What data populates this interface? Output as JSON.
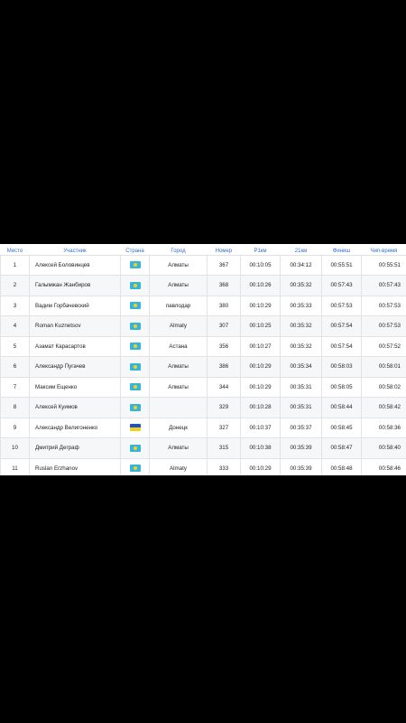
{
  "table": {
    "headers": [
      "Место",
      "Участник",
      "Страна",
      "Город",
      "Номер",
      "Р1км",
      "21км",
      "Финиш",
      "Чип-время"
    ],
    "rows": [
      {
        "place": "1",
        "name": "Алексей Боловинцев",
        "flag": "kz",
        "city": "Алматы",
        "number": "367",
        "split1": "00:10:05",
        "split2": "00:34:12",
        "finish": "00:55:51",
        "chip": "00:55:51"
      },
      {
        "place": "2",
        "name": "Галымжан Жанбиров",
        "flag": "kz",
        "city": "Алматы",
        "number": "368",
        "split1": "00:10:26",
        "split2": "00:35:32",
        "finish": "00:57:43",
        "chip": "00:57:43"
      },
      {
        "place": "3",
        "name": "Вадим Горбачевский",
        "flag": "kz",
        "city": "павлодар",
        "number": "380",
        "split1": "00:10:29",
        "split2": "00:35:33",
        "finish": "00:57:53",
        "chip": "00:57:53"
      },
      {
        "place": "4",
        "name": "Roman Kuznetsov",
        "flag": "kz",
        "city": "Almaty",
        "number": "307",
        "split1": "00:10:25",
        "split2": "00:35:32",
        "finish": "00:57:54",
        "chip": "00:57:53"
      },
      {
        "place": "5",
        "name": "Азамат Карасартов",
        "flag": "kz",
        "city": "Астана",
        "number": "356",
        "split1": "00:10:27",
        "split2": "00:35:32",
        "finish": "00:57:54",
        "chip": "00:57:52"
      },
      {
        "place": "6",
        "name": "Александр Пугачев",
        "flag": "kz",
        "city": "Алматы",
        "number": "386",
        "split1": "00:10:29",
        "split2": "00:35:34",
        "finish": "00:58:03",
        "chip": "00:58:01"
      },
      {
        "place": "7",
        "name": "Максим Ещенко",
        "flag": "kz",
        "city": "Алматы",
        "number": "344",
        "split1": "00:10:29",
        "split2": "00:35:31",
        "finish": "00:58:05",
        "chip": "00:58:02"
      },
      {
        "place": "8",
        "name": "Алексей Куимов",
        "flag": "kz",
        "city": "",
        "number": "329",
        "split1": "00:10:28",
        "split2": "00:35:31",
        "finish": "00:58:44",
        "chip": "00:58:42"
      },
      {
        "place": "9",
        "name": "Александр Велигоненко",
        "flag": "ua",
        "city": "Донецк",
        "number": "327",
        "split1": "00:10:37",
        "split2": "00:35:37",
        "finish": "00:58:45",
        "chip": "00:58:36"
      },
      {
        "place": "10",
        "name": "Дмитрий Деграф",
        "flag": "kz",
        "city": "Алматы",
        "number": "315",
        "split1": "00:10:38",
        "split2": "00:35:39",
        "finish": "00:58:47",
        "chip": "00:58:40"
      },
      {
        "place": "11",
        "name": "Ruslan Erzhanov",
        "flag": "kz",
        "city": "Almaty",
        "number": "333",
        "split1": "00:10:29",
        "split2": "00:35:39",
        "finish": "00:58:48",
        "chip": "00:58:46"
      }
    ]
  },
  "flag_icons": {
    "kz": "kazakhstan-flag-icon",
    "ua": "ukraine-flag-icon"
  },
  "colors": {
    "header_text": "#2f6fd6",
    "kz_flag": "#36b5d8",
    "ua_flag_top": "#1f4fd0",
    "ua_flag_bottom": "#f5d00f"
  }
}
